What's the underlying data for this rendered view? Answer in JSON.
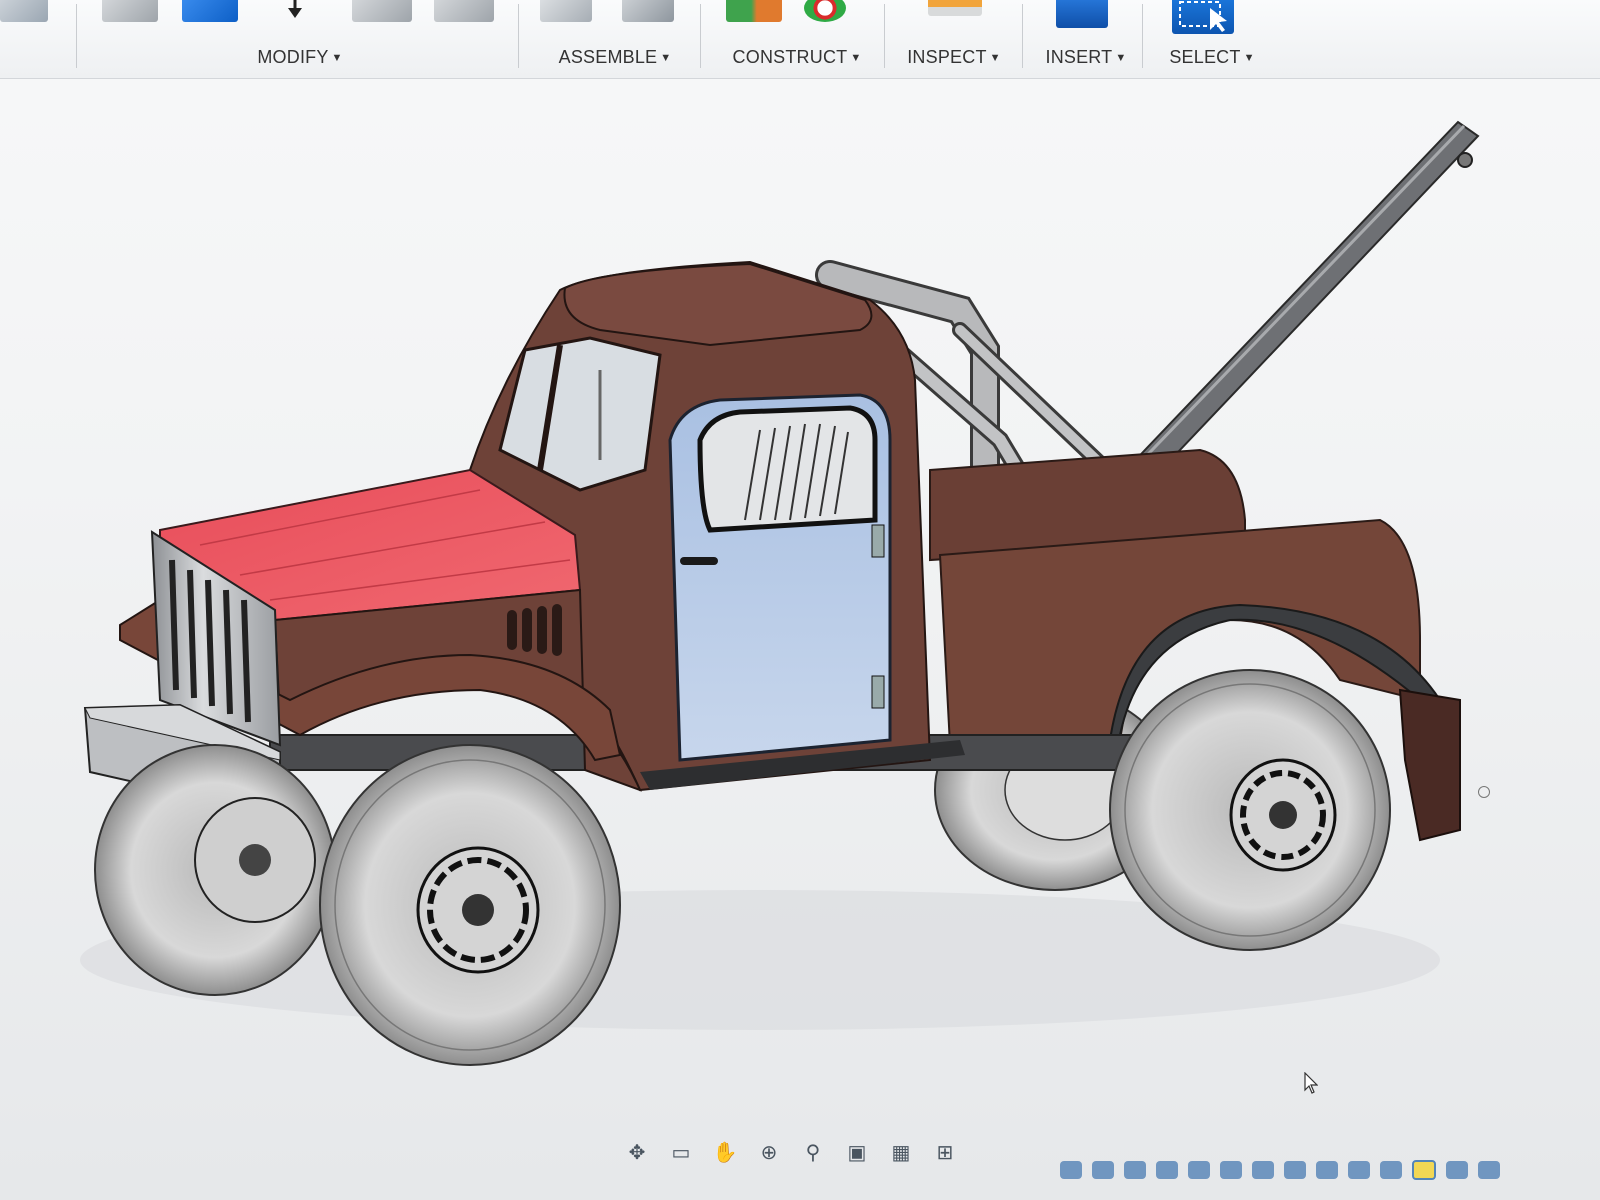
{
  "toolbar": {
    "groups": [
      {
        "label": "MODIFY"
      },
      {
        "label": "ASSEMBLE"
      },
      {
        "label": "CONSTRUCT"
      },
      {
        "label": "INSPECT"
      },
      {
        "label": "INSERT"
      },
      {
        "label": "SELECT"
      }
    ]
  },
  "colors": {
    "cab_body": "#6e4238",
    "cab_body_light": "#7c4c42",
    "hood": "#e6555f",
    "door": "#b8cce6",
    "chrome": "#c7c9cc",
    "tire": "#c9c9c9",
    "accent_blue": "#1a6ed6"
  },
  "navbar": {
    "icons": [
      "orbit-icon",
      "look-at-icon",
      "pan-icon",
      "zoom-icon",
      "fit-icon",
      "display-settings-icon",
      "grid-icon",
      "viewports-icon"
    ]
  }
}
